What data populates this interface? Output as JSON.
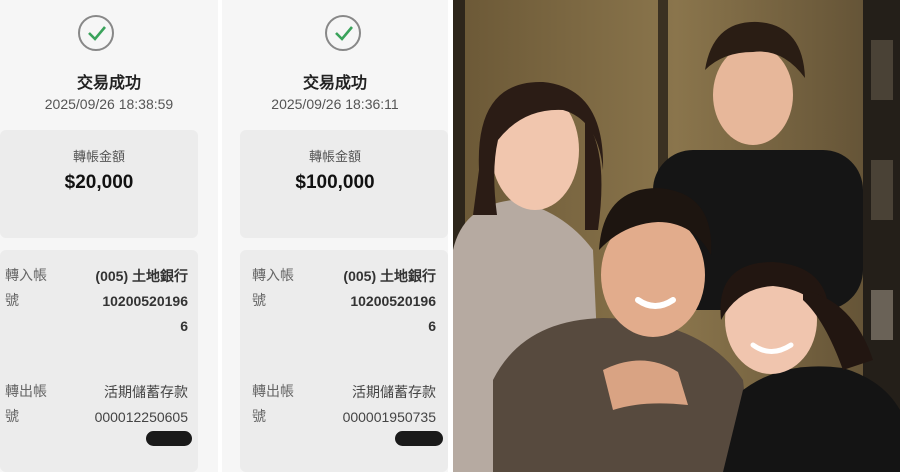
{
  "receipts": [
    {
      "status": "交易成功",
      "datetime": "2025/09/26 18:38:59",
      "amount_label": "轉帳金額",
      "amount": "$20,000",
      "in_label_1": "轉入帳",
      "in_label_2": "號",
      "in_bank": "(005) 土地銀行",
      "in_account_1": "10200520196",
      "in_account_2": "6",
      "out_label_1": "轉出帳",
      "out_label_2": "號",
      "out_type": "活期儲蓄存款",
      "out_account": "000012250605"
    },
    {
      "status": "交易成功",
      "datetime": "2025/09/26 18:36:11",
      "amount_label": "轉帳金額",
      "amount": "$100,000",
      "in_label_1": "轉入帳",
      "in_label_2": "號",
      "in_bank": "(005) 土地銀行",
      "in_account_1": "10200520196",
      "in_account_2": "6",
      "out_label_1": "轉出帳",
      "out_label_2": "號",
      "out_type": "活期儲蓄存款",
      "out_account": "000001950735"
    }
  ],
  "colors": {
    "check": "#3aa35b",
    "redaction": "#1a1a1a"
  },
  "photo": {
    "subject": "group photo of four people"
  }
}
